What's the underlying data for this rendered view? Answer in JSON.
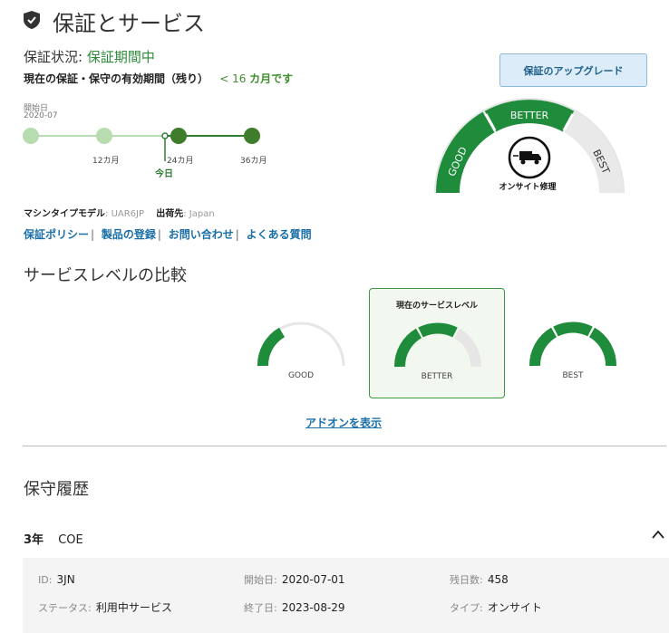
{
  "header": {
    "title": "保証とサービス",
    "icon": "shield-check-icon"
  },
  "status": {
    "label": "保証状況:",
    "value": "保証期間中",
    "remaining_label": "現在の保証・保守の有効期間（残り）",
    "remaining_prefix": "< 16",
    "remaining_suffix": "カ月です"
  },
  "timeline": {
    "start_label": "開始日",
    "start_date": "2020-07",
    "ticks": [
      "12カ月",
      "24カ月",
      "36カ月"
    ],
    "today_label": "今日"
  },
  "machine": {
    "model_label": "マシンタイプモデル",
    "model_value": "UAR6JP",
    "ship_label": "出荷先",
    "ship_value": "Japan"
  },
  "links": [
    "保証ポリシー",
    "製品の登録",
    "お問い合わせ",
    "よくある質問"
  ],
  "upgrade_button": "保証のアップグレード",
  "big_gauge": {
    "good": "GOOD",
    "better": "BETTER",
    "best": "BEST",
    "center_label": "オンサイト修理",
    "center_icon": "truck-icon"
  },
  "compare": {
    "title": "サービスレベルの比較",
    "current_label": "現在のサービスレベル",
    "levels": [
      "GOOD",
      "BETTER",
      "BEST"
    ],
    "addon_link": "アドオンを表示"
  },
  "history": {
    "title": "保守履歴",
    "contract_years": "3年",
    "contract_type": "COE",
    "details": {
      "id_label": "ID:",
      "id_value": "3JN",
      "start_label": "開始日:",
      "start_value": "2020-07-01",
      "remaining_label": "残日数:",
      "remaining_value": "458",
      "status_label": "ステータス:",
      "status_value": "利用中サービス",
      "end_label": "終了日:",
      "end_value": "2023-08-29",
      "type_label": "タイプ:",
      "type_value": "オンサイト"
    }
  },
  "colors": {
    "green": "#2e8b3a",
    "light_green": "#b7dcb0",
    "link_blue": "#1a6fa8",
    "gauge_gray": "#e6e6e6"
  }
}
